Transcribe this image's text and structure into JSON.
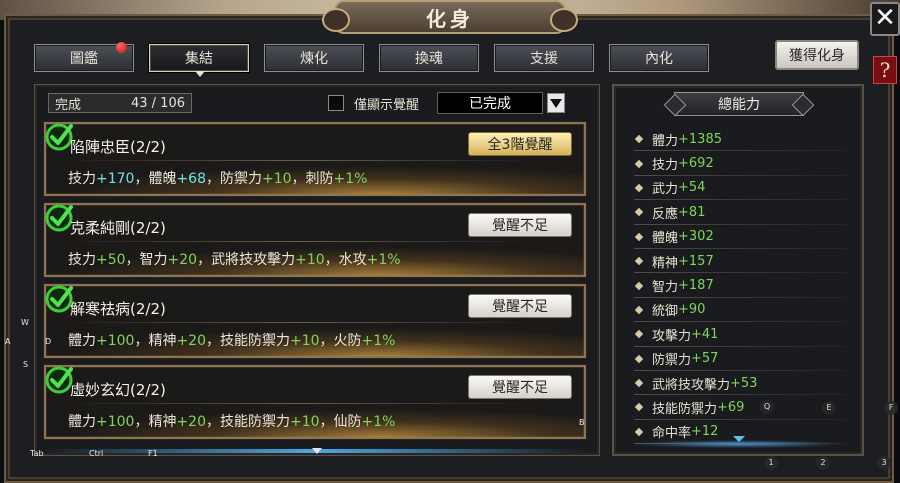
{
  "window": {
    "title": "化身"
  },
  "controls": {
    "close_label": "✕",
    "help_label": "?"
  },
  "tabs": [
    {
      "label": "圖鑑",
      "active": false,
      "has_notification": true
    },
    {
      "label": "集結",
      "active": true,
      "has_notification": false
    },
    {
      "label": "煉化",
      "active": false,
      "has_notification": false
    },
    {
      "label": "換魂",
      "active": false,
      "has_notification": false
    },
    {
      "label": "支援",
      "active": false,
      "has_notification": false
    },
    {
      "label": "內化",
      "active": false,
      "has_notification": false
    }
  ],
  "obtain_button": "獲得化身",
  "filter": {
    "completed_label": "完成",
    "completed_count": "43 / 106",
    "only_awakened_label": "僅顯示覺醒",
    "status_select": "已完成"
  },
  "cards": [
    {
      "title": "陷陣忠臣(2/2)",
      "button": "全3階覺醒",
      "button_style": "gold",
      "stats": [
        {
          "name": "技力",
          "value": "+170",
          "color": "cyan",
          "sep": "，"
        },
        {
          "name": "體魄",
          "value": "+68",
          "color": "cyan",
          "sep": "，"
        },
        {
          "name": "防禦力",
          "value": "+10",
          "color": "green",
          "sep": "，"
        },
        {
          "name": "刺防",
          "value": "+1%",
          "color": "green",
          "sep": ""
        }
      ]
    },
    {
      "title": "克柔純剛(2/2)",
      "button": "覺醒不足",
      "button_style": "normal",
      "stats": [
        {
          "name": "技力",
          "value": "+50",
          "color": "green",
          "sep": "，"
        },
        {
          "name": "智力",
          "value": "+20",
          "color": "green",
          "sep": "，"
        },
        {
          "name": "武將技攻擊力",
          "value": "+10",
          "color": "green",
          "sep": "，"
        },
        {
          "name": "水攻",
          "value": "+1%",
          "color": "green",
          "sep": ""
        }
      ]
    },
    {
      "title": "解寒祛病(2/2)",
      "button": "覺醒不足",
      "button_style": "normal",
      "stats": [
        {
          "name": "體力",
          "value": "+100",
          "color": "green",
          "sep": "，"
        },
        {
          "name": "精神",
          "value": "+20",
          "color": "green",
          "sep": "，"
        },
        {
          "name": "技能防禦力",
          "value": "+10",
          "color": "green",
          "sep": "，"
        },
        {
          "name": "火防",
          "value": "+1%",
          "color": "green",
          "sep": ""
        }
      ]
    },
    {
      "title": "虛妙玄幻(2/2)",
      "button": "覺醒不足",
      "button_style": "normal",
      "stats": [
        {
          "name": "體力",
          "value": "+100",
          "color": "green",
          "sep": "，"
        },
        {
          "name": "精神",
          "value": "+20",
          "color": "green",
          "sep": "，"
        },
        {
          "name": "技能防禦力",
          "value": "+10",
          "color": "green",
          "sep": "，"
        },
        {
          "name": "仙防",
          "value": "+1%",
          "color": "green",
          "sep": ""
        }
      ]
    }
  ],
  "total": {
    "title": "總能力",
    "stats": [
      {
        "name": "體力",
        "value": "+1385"
      },
      {
        "name": "技力",
        "value": "+692"
      },
      {
        "name": "武力",
        "value": "+54"
      },
      {
        "name": "反應",
        "value": "+81"
      },
      {
        "name": "體魄",
        "value": "+302"
      },
      {
        "name": "精神",
        "value": "+157"
      },
      {
        "name": "智力",
        "value": "+187"
      },
      {
        "name": "統御",
        "value": "+90"
      },
      {
        "name": "攻擊力",
        "value": "+41"
      },
      {
        "name": "防禦力",
        "value": "+57"
      },
      {
        "name": "武將技攻擊力",
        "value": "+53"
      },
      {
        "name": "技能防禦力",
        "value": "+69"
      },
      {
        "name": "命中率",
        "value": "+12"
      }
    ]
  },
  "hotkeys": {
    "w": "W",
    "a": "A",
    "d": "D",
    "s": "S",
    "tab": "Tab",
    "ctrl": "Ctrl",
    "f1": "F1",
    "q": "Q",
    "e": "E",
    "f": "F",
    "b": "B",
    "one": "1",
    "two": "2",
    "three": "3"
  },
  "colors": {
    "stat_green": "#7fd65a",
    "stat_cyan": "#6ee2ea",
    "frame_gold": "#8a7556"
  }
}
